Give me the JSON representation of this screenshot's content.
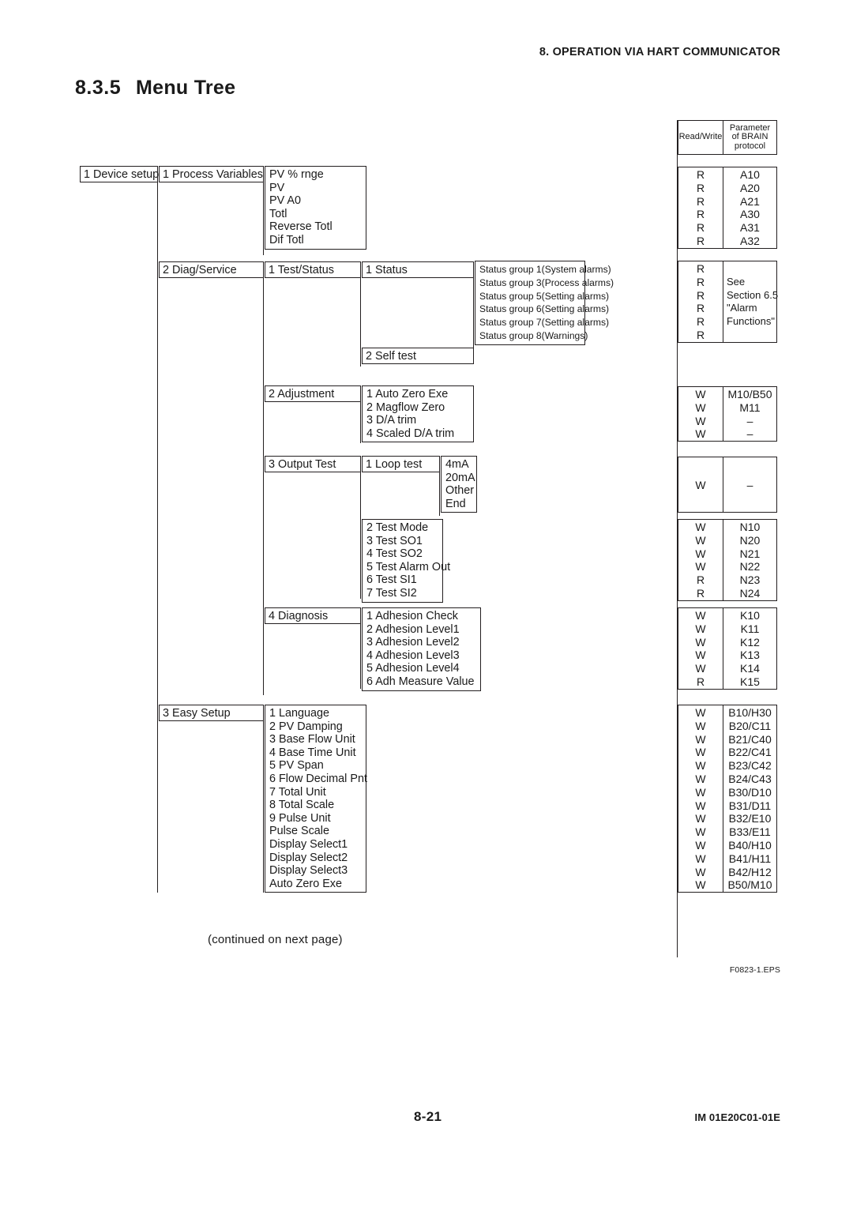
{
  "running_header": "8. OPERATION VIA HART COMMUNICATOR",
  "section": {
    "number": "8.3.5",
    "title": "Menu Tree"
  },
  "legend": {
    "read_write": "Read/Write",
    "parameter": "Parameter\nof BRAIN\nprotocol"
  },
  "legend_rw": "Read/Write",
  "legend_param_l1": "Parameter",
  "legend_param_l2": "of BRAIN",
  "legend_param_l3": "protocol",
  "tree": {
    "root": "1 Device setup",
    "l2": {
      "process_variables": "1 Process Variables",
      "diag_service": "2 Diag/Service",
      "easy_setup": "3 Easy Setup"
    },
    "l3": {
      "test_status": "1 Test/Status",
      "adjustment": "2 Adjustment",
      "output_test": "3 Output Test",
      "diagnosis": "4 Diagnosis"
    },
    "l4": {
      "status": "1 Status",
      "self_test": "2 Self test",
      "loop_test": "1 Loop test"
    }
  },
  "lists": {
    "process_variables": [
      "PV % rnge",
      "PV",
      "PV A0",
      "Totl",
      "Reverse Totl",
      "Dif Totl"
    ],
    "status_groups": [
      "Status group 1(System alarms)",
      "Status group 3(Process alarms)",
      "Status group 5(Setting alarms)",
      "Status group 6(Setting alarms)",
      "Status group 7(Setting alarms)",
      "Status group 8(Warnings)"
    ],
    "adjustment": [
      "1 Auto Zero Exe",
      "2 Magflow Zero",
      "3 D/A trim",
      "4 Scaled D/A trim"
    ],
    "loop_test": [
      "4mA",
      "20mA",
      "Other",
      "End"
    ],
    "output_test": [
      "2 Test Mode",
      "3 Test SO1",
      "4 Test SO2",
      "5 Test Alarm Out",
      "6 Test SI1",
      "7 Test SI2"
    ],
    "diagnosis": [
      "1 Adhesion Check",
      "2 Adhesion Level1",
      "3 Adhesion Level2",
      "4 Adhesion Level3",
      "5 Adhesion Level4",
      "6 Adh Measure Value"
    ],
    "easy_setup": [
      "1 Language",
      "2 PV Damping",
      "3 Base Flow Unit",
      "4 Base Time Unit",
      "5 PV Span",
      "6 Flow Decimal Pnt",
      "7 Total Unit",
      "8 Total Scale",
      "9 Pulse Unit",
      " Pulse Scale",
      " Display Select1",
      " Display Select2",
      " Display Select3",
      " Auto Zero Exe"
    ]
  },
  "param_tables": {
    "process_variables": {
      "rw": [
        "R",
        "R",
        "R",
        "R",
        "R",
        "R"
      ],
      "param": [
        "A10",
        "A20",
        "A21",
        "A30",
        "A31",
        "A32"
      ]
    },
    "status": {
      "rw": [
        "R",
        "R",
        "R",
        "R",
        "R",
        "R"
      ],
      "param": [
        "",
        "See",
        "Section 6.5",
        "\"Alarm",
        "Functions\"",
        ""
      ]
    },
    "adjustment": {
      "rw": [
        "W",
        "W",
        "W",
        "W"
      ],
      "param": [
        "M10/B50",
        "M11",
        "–",
        "–"
      ]
    },
    "loop_test": {
      "rw": [
        "W"
      ],
      "param": [
        "–"
      ]
    },
    "output_test": {
      "rw": [
        "W",
        "W",
        "W",
        "W",
        "R",
        "R"
      ],
      "param": [
        "N10",
        "N20",
        "N21",
        "N22",
        "N23",
        "N24"
      ]
    },
    "diagnosis": {
      "rw": [
        "W",
        "W",
        "W",
        "W",
        "W",
        "R"
      ],
      "param": [
        "K10",
        "K11",
        "K12",
        "K13",
        "K14",
        "K15"
      ]
    },
    "easy_setup": {
      "rw": [
        "W",
        "W",
        "W",
        "W",
        "W",
        "W",
        "W",
        "W",
        "W",
        "W",
        "W",
        "W",
        "W",
        "W"
      ],
      "param": [
        "B10/H30",
        "B20/C11",
        "B21/C40",
        "B22/C41",
        "B23/C42",
        "B24/C43",
        "B30/D10",
        "B31/D11",
        "B32/E10",
        "B33/E11",
        "B40/H10",
        "B41/H11",
        "B42/H12",
        "B50/M10"
      ]
    }
  },
  "footer": {
    "continued": "(continued on next page)",
    "eps": "F0823-1.EPS",
    "page": "8-21",
    "doc": "IM 01E20C01-01E"
  }
}
